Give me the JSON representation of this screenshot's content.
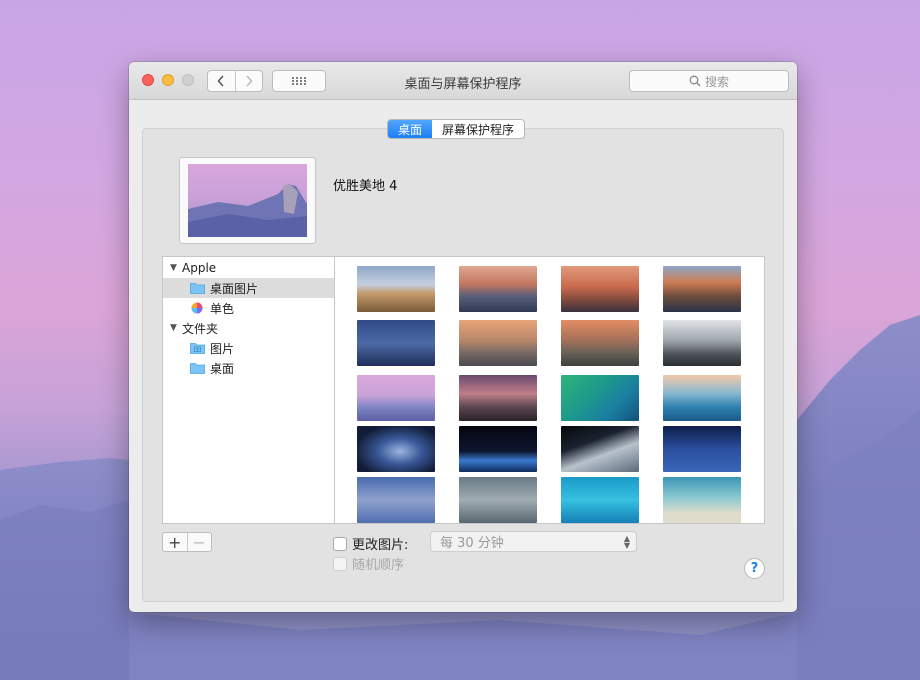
{
  "window": {
    "title": "桌面与屏幕保护程序"
  },
  "search": {
    "placeholder": "搜索"
  },
  "tabs": [
    {
      "label": "桌面",
      "active": true
    },
    {
      "label": "屏幕保护程序",
      "active": false
    }
  ],
  "preview": {
    "name": "优胜美地 4"
  },
  "sidebar": {
    "groups": [
      {
        "label": "Apple",
        "items": [
          {
            "label": "桌面图片",
            "icon": "folder-icon",
            "selected": true
          },
          {
            "label": "单色",
            "icon": "color-wheel-icon",
            "selected": false
          }
        ]
      },
      {
        "label": "文件夹",
        "items": [
          {
            "label": "图片",
            "icon": "photos-folder-icon",
            "selected": false
          },
          {
            "label": "桌面",
            "icon": "folder-icon",
            "selected": false
          }
        ]
      }
    ]
  },
  "controls": {
    "change_picture_label": "更改图片:",
    "interval_value": "每 30 分钟",
    "random_order_label": "随机顺序",
    "help_label": "?",
    "add_label": "+",
    "remove_label": "−"
  },
  "colors": {
    "accent": "#1c7ff5",
    "close": "#fc605c",
    "minimize": "#fdbc40"
  }
}
